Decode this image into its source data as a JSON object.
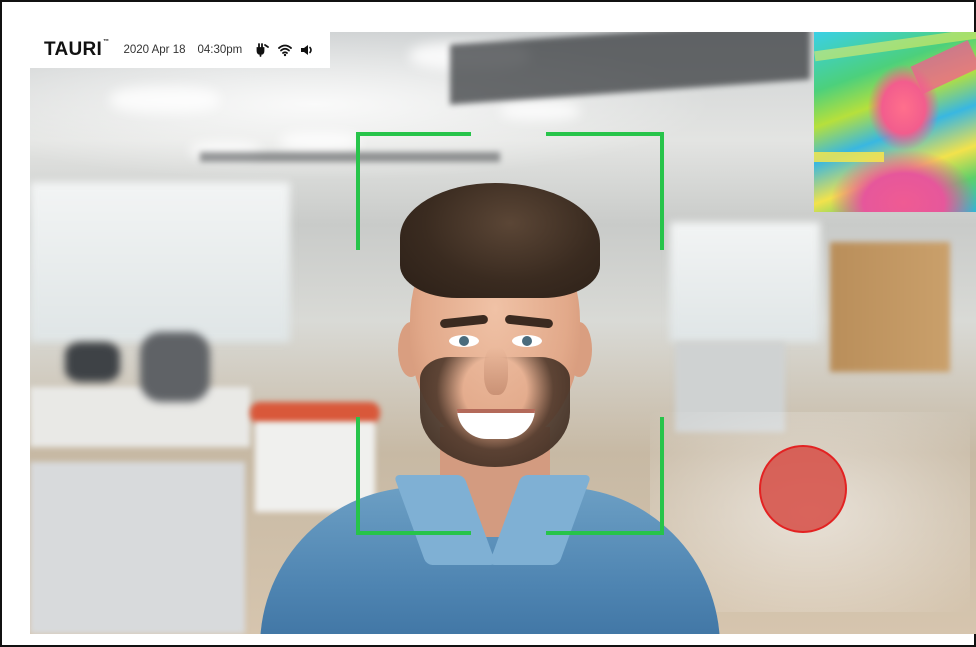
{
  "status_bar": {
    "logo": "TAURI",
    "logo_tm": "™",
    "date": "2020 Apr 18",
    "time": "04:30pm",
    "icons": [
      "plug-icon",
      "wifi-icon",
      "speaker-icon"
    ]
  },
  "face_detection": {
    "bracket_color": "#27c44a"
  },
  "thermal_preview": {
    "palette": [
      "#3ad0e6",
      "#4cd07c",
      "#f2e24c",
      "#ef5b93"
    ]
  },
  "temperature_indicator": {
    "color": "#d64d45",
    "border": "#e32222"
  }
}
